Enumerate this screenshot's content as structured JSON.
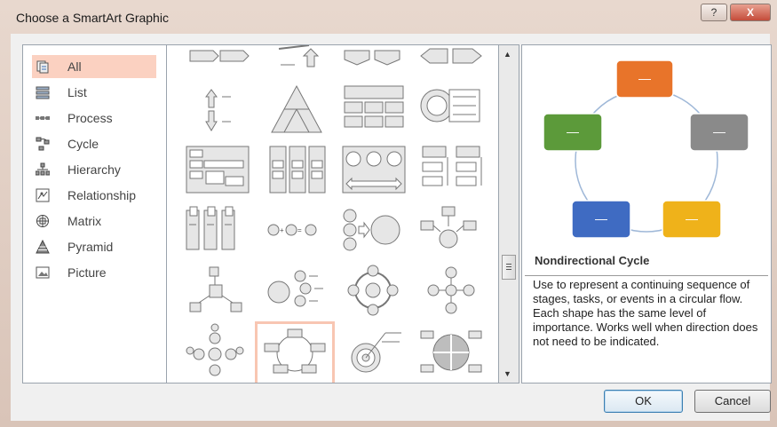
{
  "window": {
    "title": "Choose a SmartArt Graphic",
    "help_label": "?",
    "close_label": "X"
  },
  "categories": [
    {
      "label": "All",
      "icon": "all-layouts-icon",
      "selected": true
    },
    {
      "label": "List",
      "icon": "list-icon"
    },
    {
      "label": "Process",
      "icon": "process-icon"
    },
    {
      "label": "Cycle",
      "icon": "cycle-icon"
    },
    {
      "label": "Hierarchy",
      "icon": "hierarchy-icon"
    },
    {
      "label": "Relationship",
      "icon": "relationship-icon"
    },
    {
      "label": "Matrix",
      "icon": "matrix-icon"
    },
    {
      "label": "Pyramid",
      "icon": "pyramid-icon"
    },
    {
      "label": "Picture",
      "icon": "picture-icon"
    }
  ],
  "gallery": {
    "selected_layout": "Nondirectional Cycle",
    "scroll_up": "▲",
    "scroll_down": "▼"
  },
  "preview": {
    "title": "Nondirectional Cycle",
    "description": "Use to represent a continuing sequence of stages, tasks, or events in a circular flow. Each shape has the same level of importance. Works well when direction does not need to be indicated.",
    "shape_colors": [
      "#e8742a",
      "#8a8a8a",
      "#efb21a",
      "#3f6bc2",
      "#5c9a3a"
    ],
    "shape_label": "—"
  },
  "buttons": {
    "ok_label": "OK",
    "cancel_label": "Cancel"
  }
}
